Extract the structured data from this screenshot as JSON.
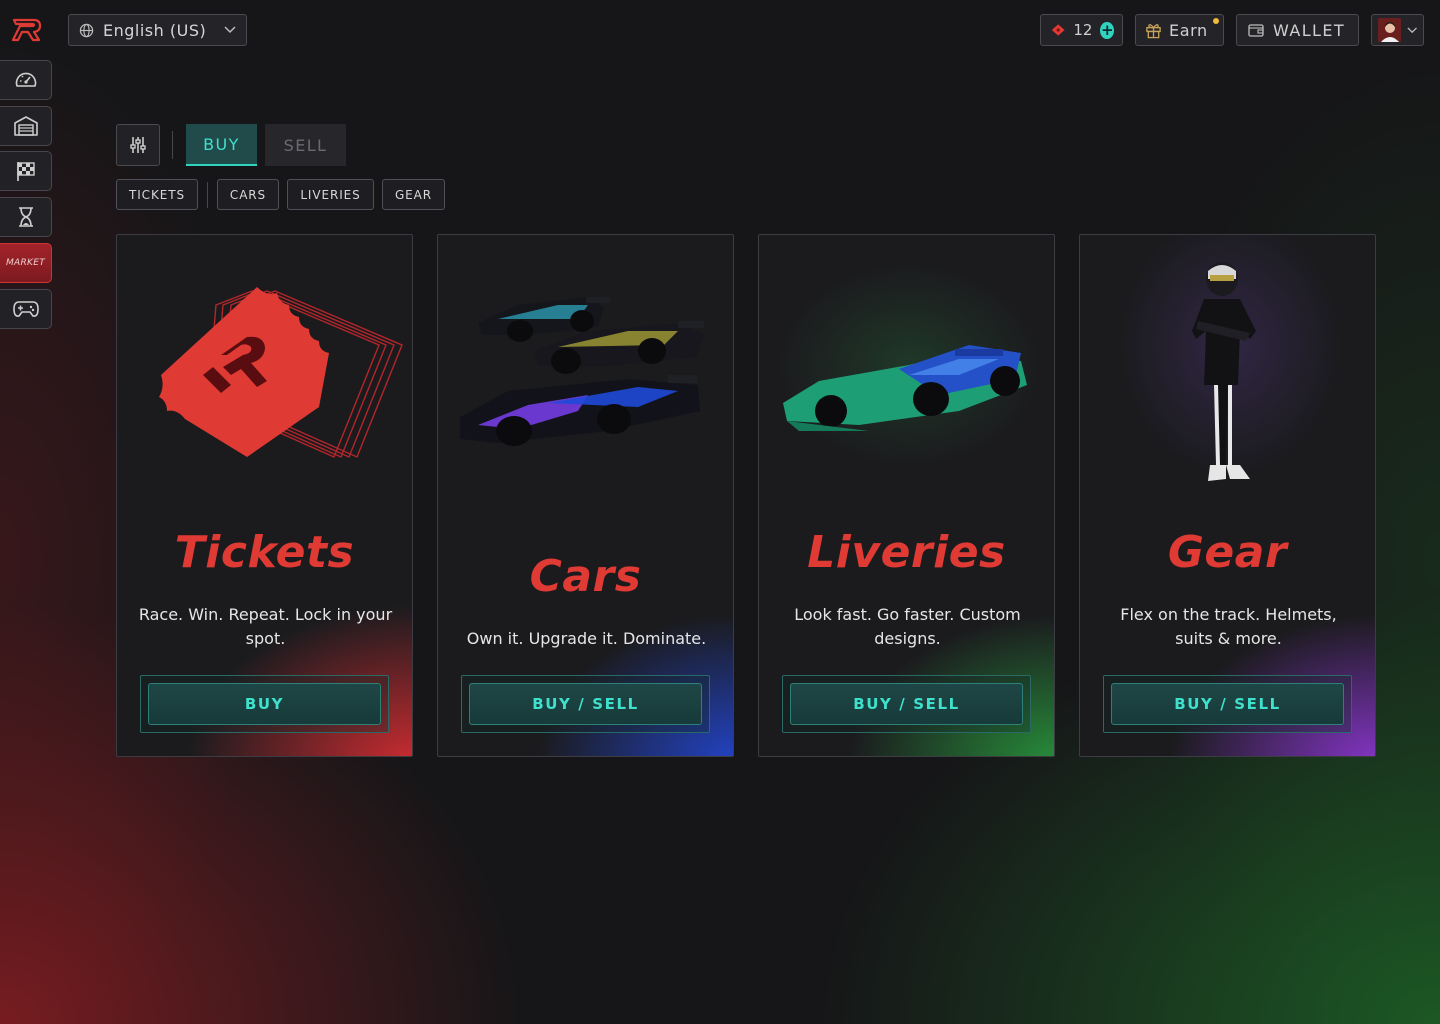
{
  "header": {
    "language_label": "English (US)",
    "tickets_count": "12",
    "plus_symbol": "+",
    "earn_label": "Earn",
    "wallet_label": "WALLET"
  },
  "sidebar": {
    "items": [
      {
        "icon": "speedometer-icon"
      },
      {
        "icon": "garage-icon"
      },
      {
        "icon": "race-flag-icon"
      },
      {
        "icon": "hourglass-icon"
      },
      {
        "label": "MARKET",
        "active": true
      },
      {
        "icon": "gamepad-icon"
      }
    ]
  },
  "toolbar": {
    "tabs": [
      {
        "label": "BUY",
        "active": true
      },
      {
        "label": "SELL",
        "active": false
      }
    ],
    "categories": [
      "TICKETS",
      "CARS",
      "LIVERIES",
      "GEAR"
    ]
  },
  "cards": [
    {
      "title": "Tickets",
      "description": "Race. Win. Repeat. Lock in your spot.",
      "button": "BUY",
      "accent": "#d8303a"
    },
    {
      "title": "Cars",
      "description": "Own it. Upgrade it. Dominate.",
      "button": "BUY / SELL",
      "accent": "#2348c8"
    },
    {
      "title": "Liveries",
      "description": "Look fast. Go faster. Custom designs.",
      "button": "BUY / SELL",
      "accent": "#2a9a44"
    },
    {
      "title": "Gear",
      "description": "Flex on the track. Helmets, suits & more.",
      "button": "BUY / SELL",
      "accent": "#8a35d0"
    }
  ],
  "colors": {
    "brand_red": "#e03a34",
    "accent_teal": "#2fd3c0",
    "background": "#161618"
  }
}
